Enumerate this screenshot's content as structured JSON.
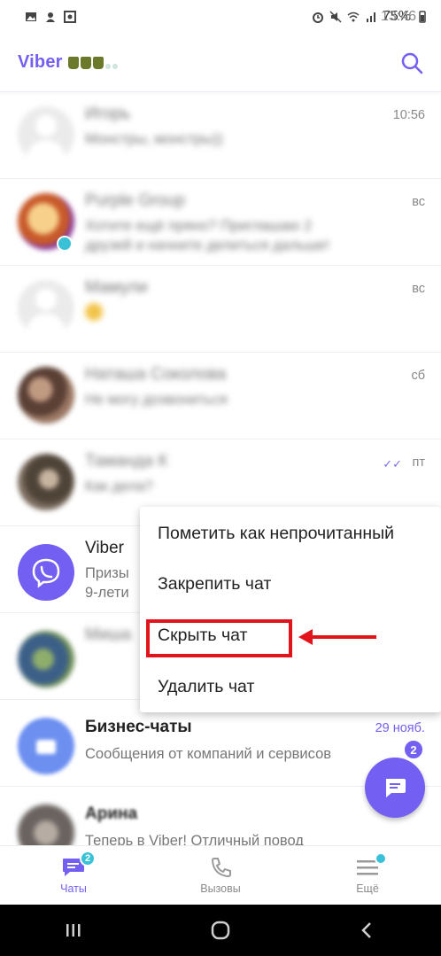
{
  "status_bar": {
    "time": "13:46",
    "battery": "75%"
  },
  "app_bar": {
    "title": "Viber"
  },
  "chats": [
    {
      "name": "Игорь",
      "preview": "Монстры, монстры))",
      "time": "10:56",
      "blurred": true
    },
    {
      "name": "Purple Group",
      "preview": "Хотите ещё пряно? Приглашаю 2 друзей и начните делиться дальше!",
      "time": "вс",
      "blurred": true
    },
    {
      "name": "Мамули",
      "preview": "",
      "time": "вс",
      "blurred": true
    },
    {
      "name": "Наташа Соколова",
      "preview": "Не могу дозвониться",
      "time": "сб",
      "blurred": true
    },
    {
      "name": "Таманда К",
      "preview": "Как дела?",
      "time": "пт",
      "blurred": true
    },
    {
      "name": "Viber",
      "preview": "Призы",
      "preview2": "9-лети",
      "time": "",
      "blurred": false
    },
    {
      "name": "Миша",
      "preview": "",
      "time": "",
      "blurred": true
    },
    {
      "name": "Бизнес-чаты",
      "preview": "Сообщения от компаний и сервисов",
      "time": "29 нояб.",
      "blurred": false
    },
    {
      "name": "Арина",
      "preview": "Теперь в Viber! Отличный повод",
      "time": "",
      "blurred": false
    }
  ],
  "context_menu": {
    "items": [
      "Пометить как непрочитанный",
      "Закрепить чат",
      "Скрыть чат",
      "Удалить чат"
    ]
  },
  "fab": {
    "badge": "2"
  },
  "bottom_nav": {
    "tabs": [
      {
        "label": "Чаты",
        "badge": "2"
      },
      {
        "label": "Вызовы"
      },
      {
        "label": "Ещё"
      }
    ]
  },
  "colors": {
    "accent": "#7360f2",
    "badge": "#39c1d8",
    "highlight": "#e2141b"
  }
}
